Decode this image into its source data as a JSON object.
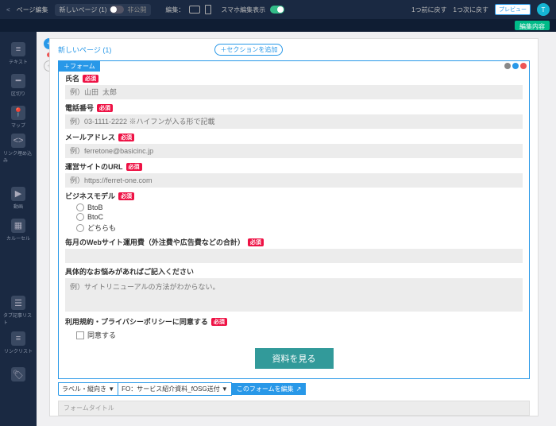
{
  "topbar": {
    "breadcrumb": "ページ編集",
    "tab_label": "新しいページ (1)",
    "tab_status": "非公開",
    "edit_label": "編集：",
    "smartphone_label": "スマホ編集表示",
    "undo": "1つ前に戻す",
    "redo": "1つ次に戻す",
    "preview": "プレビュー",
    "save": "編集内容"
  },
  "tools": [
    {
      "icon": "≡",
      "label": "テキスト"
    },
    {
      "icon": "━",
      "label": "区切り"
    },
    {
      "icon": "📍",
      "label": "マップ"
    },
    {
      "icon": "<>",
      "label": "リンク埋め込み"
    },
    {
      "icon": "▶",
      "label": "動画"
    },
    {
      "icon": "▦",
      "label": "カルーセル"
    },
    {
      "icon": "☰",
      "label": "タブ記事リスト"
    },
    {
      "icon": "≡",
      "label": "リンクリスト"
    },
    {
      "icon": "🏷",
      "label": ""
    }
  ],
  "page_title": "新しいページ (1)",
  "section_btn": "＋セクションを追加",
  "form_tag": "＋フォーム",
  "form": {
    "name": {
      "label": "氏名",
      "req": "必須",
      "placeholder": "例）山田  太郎"
    },
    "phone": {
      "label": "電話番号",
      "req": "必須",
      "placeholder": "例）03-1111-2222 ※ハイフンが入る形で記載"
    },
    "email": {
      "label": "メールアドレス",
      "req": "必須",
      "placeholder": "例）ferretone@basicinc.jp"
    },
    "url": {
      "label": "運営サイトのURL",
      "req": "必須",
      "placeholder": "例）https://ferret-one.com"
    },
    "model": {
      "label": "ビジネスモデル",
      "req": "必須",
      "options": [
        "BtoB",
        "BtoC",
        "どちらも"
      ]
    },
    "budget": {
      "label": "毎月のWebサイト運用費（外注費や広告費などの合計）",
      "req": "必須"
    },
    "problem": {
      "label": "具体的なお悩みがあればご記入ください",
      "placeholder": "例）サイトリニューアルの方法がわからない。"
    },
    "agree": {
      "label": "利用規約・プライバシーポリシーに同意する",
      "req": "必須",
      "checkbox": "同意する"
    },
    "submit": "資料を見る"
  },
  "footer": {
    "sel1": "ラベル・縦向き ▼",
    "sel2": "FO：サービス紹介資料_fOSG送付 ▼",
    "edit_btn": "このフォームを編集",
    "title_placeholder": "フォームタイトル"
  }
}
